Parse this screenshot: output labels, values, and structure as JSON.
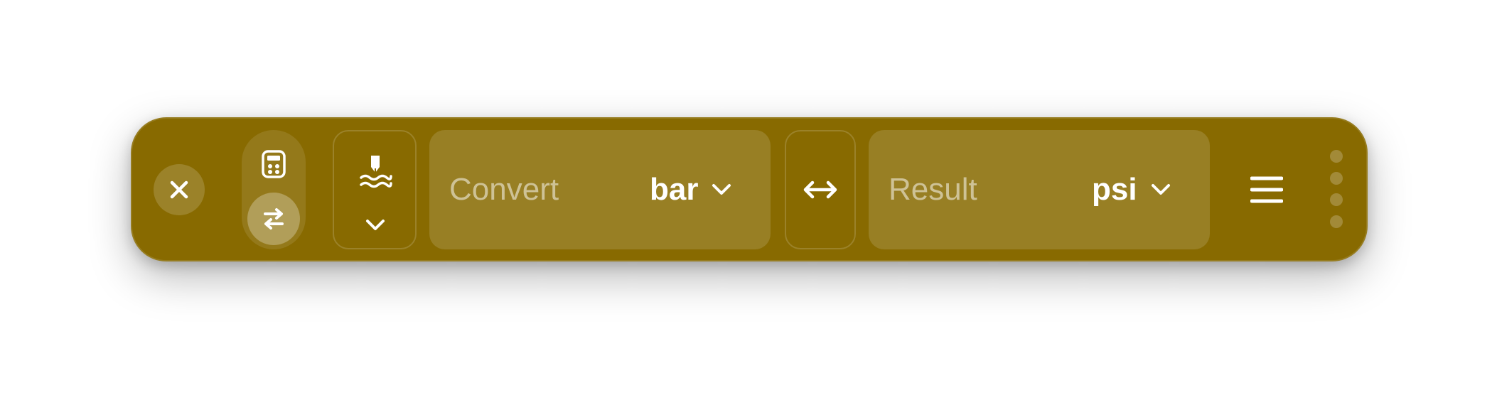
{
  "theme": {
    "accent": "#886a00",
    "text": "#ffffff",
    "muted_text": "rgba(255,255,255,0.52)"
  },
  "toolbar": {
    "close_icon": "close-icon",
    "mode_calculator_icon": "calculator-icon",
    "mode_converter_icon": "swap-arrows-icon",
    "category_icon": "pressure-icon",
    "category_chevron_icon": "chevron-down-icon",
    "swap_icon": "swap-horizontal-icon",
    "menu_icon": "hamburger-menu-icon",
    "drag_handle_icon": "drag-handle-icon"
  },
  "from": {
    "placeholder": "Convert",
    "unit": "bar"
  },
  "to": {
    "placeholder": "Result",
    "unit": "psi"
  }
}
